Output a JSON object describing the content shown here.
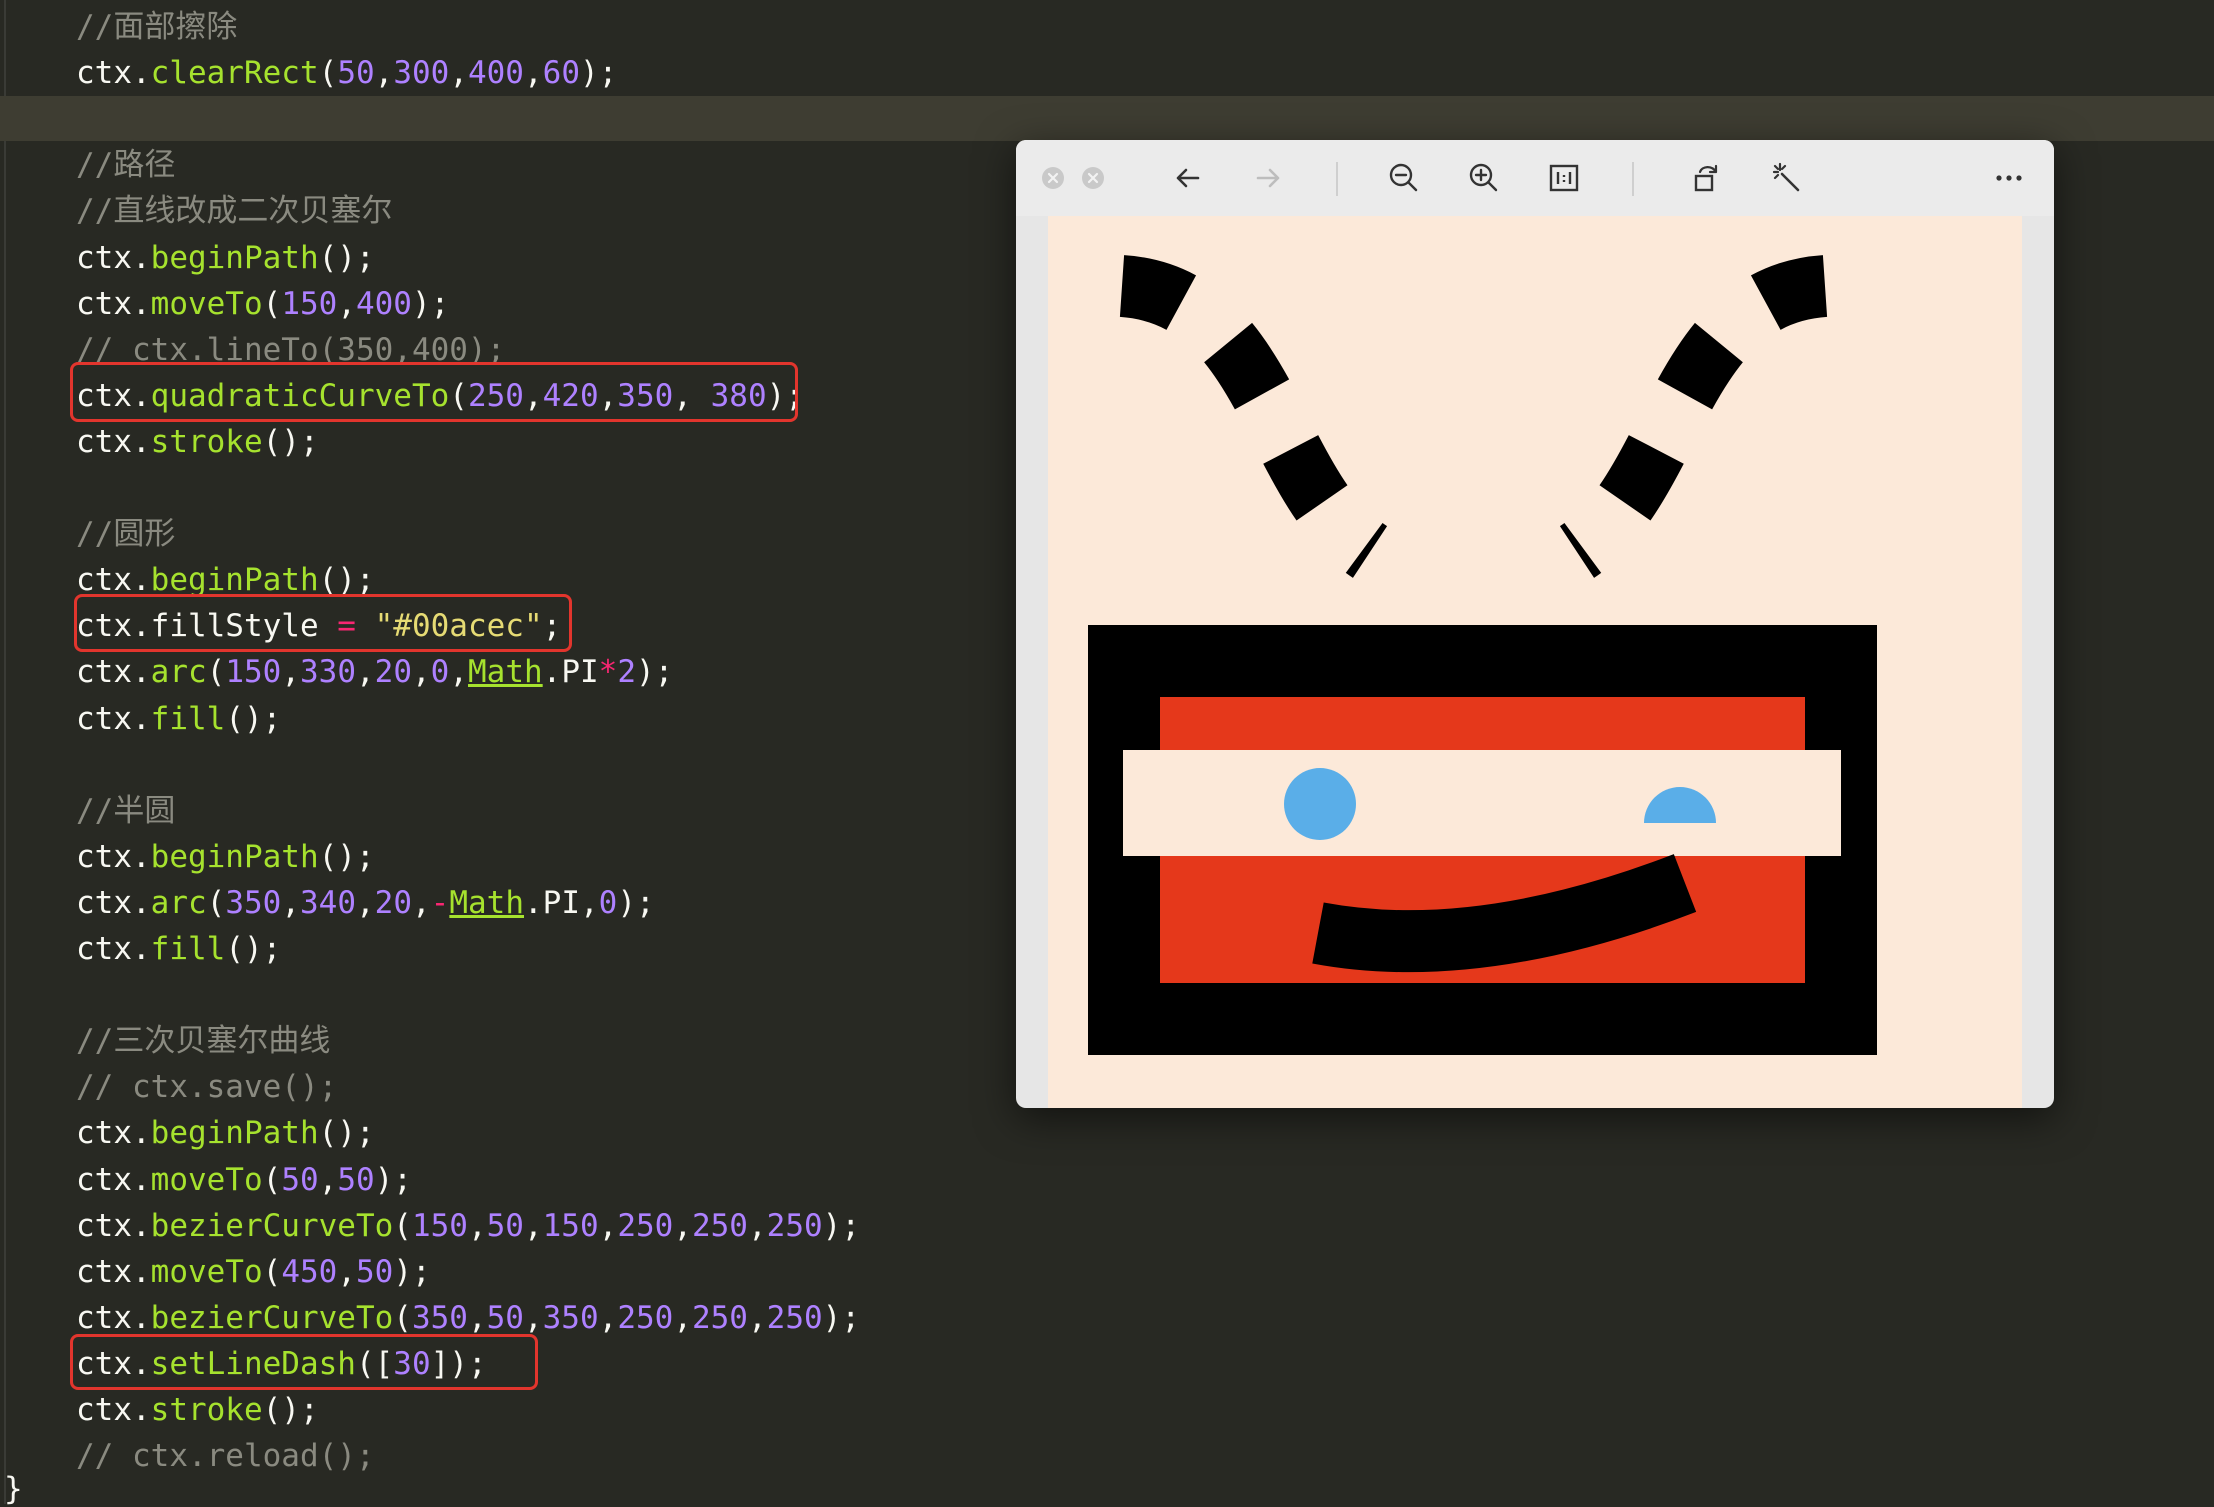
{
  "editor": {
    "lines": [
      [
        {
          "t": "//面部擦除",
          "c": "cm"
        }
      ],
      [
        {
          "t": "ctx.",
          "c": "punc"
        },
        {
          "t": "clearRect",
          "c": "fn"
        },
        {
          "t": "(",
          "c": "punc"
        },
        {
          "t": "50",
          "c": "num"
        },
        {
          "t": ",",
          "c": "punc"
        },
        {
          "t": "300",
          "c": "num"
        },
        {
          "t": ",",
          "c": "punc"
        },
        {
          "t": "400",
          "c": "num"
        },
        {
          "t": ",",
          "c": "punc"
        },
        {
          "t": "60",
          "c": "num"
        },
        {
          "t": ");",
          "c": "punc"
        }
      ],
      [],
      [
        {
          "t": "//路径",
          "c": "cm"
        }
      ],
      [
        {
          "t": "//直线改成二次贝塞尔",
          "c": "cm"
        }
      ],
      [
        {
          "t": "ctx.",
          "c": "punc"
        },
        {
          "t": "beginPath",
          "c": "fn"
        },
        {
          "t": "();",
          "c": "punc"
        }
      ],
      [
        {
          "t": "ctx.",
          "c": "punc"
        },
        {
          "t": "moveTo",
          "c": "fn"
        },
        {
          "t": "(",
          "c": "punc"
        },
        {
          "t": "150",
          "c": "num"
        },
        {
          "t": ",",
          "c": "punc"
        },
        {
          "t": "400",
          "c": "num"
        },
        {
          "t": ");",
          "c": "punc"
        }
      ],
      [
        {
          "t": "// ctx.lineTo(350,400);",
          "c": "cm"
        }
      ],
      [
        {
          "t": "ctx.",
          "c": "punc"
        },
        {
          "t": "quadraticCurveTo",
          "c": "fn"
        },
        {
          "t": "(",
          "c": "punc"
        },
        {
          "t": "250",
          "c": "num"
        },
        {
          "t": ",",
          "c": "punc"
        },
        {
          "t": "420",
          "c": "num"
        },
        {
          "t": ",",
          "c": "punc"
        },
        {
          "t": "350",
          "c": "num"
        },
        {
          "t": ", ",
          "c": "punc"
        },
        {
          "t": "380",
          "c": "num"
        },
        {
          "t": ");",
          "c": "punc"
        }
      ],
      [
        {
          "t": "ctx.",
          "c": "punc"
        },
        {
          "t": "stroke",
          "c": "fn"
        },
        {
          "t": "();",
          "c": "punc"
        }
      ],
      [],
      [
        {
          "t": "//圆形",
          "c": "cm"
        }
      ],
      [
        {
          "t": "ctx.",
          "c": "punc"
        },
        {
          "t": "beginPath",
          "c": "fn"
        },
        {
          "t": "();",
          "c": "punc"
        }
      ],
      [
        {
          "t": "ctx.fillStyle ",
          "c": "punc"
        },
        {
          "t": "=",
          "c": "op"
        },
        {
          "t": " ",
          "c": "punc"
        },
        {
          "t": "\"#00acec\"",
          "c": "str"
        },
        {
          "t": ";",
          "c": "punc"
        }
      ],
      [
        {
          "t": "ctx.",
          "c": "punc"
        },
        {
          "t": "arc",
          "c": "fn"
        },
        {
          "t": "(",
          "c": "punc"
        },
        {
          "t": "150",
          "c": "num"
        },
        {
          "t": ",",
          "c": "punc"
        },
        {
          "t": "330",
          "c": "num"
        },
        {
          "t": ",",
          "c": "punc"
        },
        {
          "t": "20",
          "c": "num"
        },
        {
          "t": ",",
          "c": "punc"
        },
        {
          "t": "0",
          "c": "num"
        },
        {
          "t": ",",
          "c": "punc"
        },
        {
          "t": "Math",
          "c": "kw"
        },
        {
          "t": ".PI",
          "c": "punc"
        },
        {
          "t": "*",
          "c": "op"
        },
        {
          "t": "2",
          "c": "num"
        },
        {
          "t": ");",
          "c": "punc"
        }
      ],
      [
        {
          "t": "ctx.",
          "c": "punc"
        },
        {
          "t": "fill",
          "c": "fn"
        },
        {
          "t": "();",
          "c": "punc"
        }
      ],
      [],
      [
        {
          "t": "//半圆",
          "c": "cm"
        }
      ],
      [
        {
          "t": "ctx.",
          "c": "punc"
        },
        {
          "t": "beginPath",
          "c": "fn"
        },
        {
          "t": "();",
          "c": "punc"
        }
      ],
      [
        {
          "t": "ctx.",
          "c": "punc"
        },
        {
          "t": "arc",
          "c": "fn"
        },
        {
          "t": "(",
          "c": "punc"
        },
        {
          "t": "350",
          "c": "num"
        },
        {
          "t": ",",
          "c": "punc"
        },
        {
          "t": "340",
          "c": "num"
        },
        {
          "t": ",",
          "c": "punc"
        },
        {
          "t": "20",
          "c": "num"
        },
        {
          "t": ",",
          "c": "punc"
        },
        {
          "t": "-",
          "c": "op"
        },
        {
          "t": "Math",
          "c": "kw"
        },
        {
          "t": ".PI,",
          "c": "punc"
        },
        {
          "t": "0",
          "c": "num"
        },
        {
          "t": ");",
          "c": "punc"
        }
      ],
      [
        {
          "t": "ctx.",
          "c": "punc"
        },
        {
          "t": "fill",
          "c": "fn"
        },
        {
          "t": "();",
          "c": "punc"
        }
      ],
      [],
      [
        {
          "t": "//三次贝塞尔曲线",
          "c": "cm"
        }
      ],
      [
        {
          "t": "// ctx.save();",
          "c": "cm"
        }
      ],
      [
        {
          "t": "ctx.",
          "c": "punc"
        },
        {
          "t": "beginPath",
          "c": "fn"
        },
        {
          "t": "();",
          "c": "punc"
        }
      ],
      [
        {
          "t": "ctx.",
          "c": "punc"
        },
        {
          "t": "moveTo",
          "c": "fn"
        },
        {
          "t": "(",
          "c": "punc"
        },
        {
          "t": "50",
          "c": "num"
        },
        {
          "t": ",",
          "c": "punc"
        },
        {
          "t": "50",
          "c": "num"
        },
        {
          "t": ");",
          "c": "punc"
        }
      ],
      [
        {
          "t": "ctx.",
          "c": "punc"
        },
        {
          "t": "bezierCurveTo",
          "c": "fn"
        },
        {
          "t": "(",
          "c": "punc"
        },
        {
          "t": "150",
          "c": "num"
        },
        {
          "t": ",",
          "c": "punc"
        },
        {
          "t": "50",
          "c": "num"
        },
        {
          "t": ",",
          "c": "punc"
        },
        {
          "t": "150",
          "c": "num"
        },
        {
          "t": ",",
          "c": "punc"
        },
        {
          "t": "250",
          "c": "num"
        },
        {
          "t": ",",
          "c": "punc"
        },
        {
          "t": "250",
          "c": "num"
        },
        {
          "t": ",",
          "c": "punc"
        },
        {
          "t": "250",
          "c": "num"
        },
        {
          "t": ");",
          "c": "punc"
        }
      ],
      [
        {
          "t": "ctx.",
          "c": "punc"
        },
        {
          "t": "moveTo",
          "c": "fn"
        },
        {
          "t": "(",
          "c": "punc"
        },
        {
          "t": "450",
          "c": "num"
        },
        {
          "t": ",",
          "c": "punc"
        },
        {
          "t": "50",
          "c": "num"
        },
        {
          "t": ");",
          "c": "punc"
        }
      ],
      [
        {
          "t": "ctx.",
          "c": "punc"
        },
        {
          "t": "bezierCurveTo",
          "c": "fn"
        },
        {
          "t": "(",
          "c": "punc"
        },
        {
          "t": "350",
          "c": "num"
        },
        {
          "t": ",",
          "c": "punc"
        },
        {
          "t": "50",
          "c": "num"
        },
        {
          "t": ",",
          "c": "punc"
        },
        {
          "t": "350",
          "c": "num"
        },
        {
          "t": ",",
          "c": "punc"
        },
        {
          "t": "250",
          "c": "num"
        },
        {
          "t": ",",
          "c": "punc"
        },
        {
          "t": "250",
          "c": "num"
        },
        {
          "t": ",",
          "c": "punc"
        },
        {
          "t": "250",
          "c": "num"
        },
        {
          "t": ");",
          "c": "punc"
        }
      ],
      [
        {
          "t": "ctx.",
          "c": "punc"
        },
        {
          "t": "setLineDash",
          "c": "fn"
        },
        {
          "t": "([",
          "c": "punc"
        },
        {
          "t": "30",
          "c": "num"
        },
        {
          "t": "]);",
          "c": "punc"
        }
      ],
      [
        {
          "t": "ctx.",
          "c": "punc"
        },
        {
          "t": "stroke",
          "c": "fn"
        },
        {
          "t": "();",
          "c": "punc"
        }
      ],
      [
        {
          "t": "// ctx.reload();",
          "c": "cm"
        }
      ]
    ],
    "closing_brace": "}",
    "highlighted_lines": [
      8,
      13,
      29
    ],
    "current_line": 2,
    "colors": {
      "bg": "#282923",
      "comment": "#8a8a80",
      "function": "#a6e22e",
      "number": "#ae81ff",
      "string": "#e6db74",
      "operator": "#f92672",
      "text": "#f8f8f2",
      "highlight_box": "#e2352d"
    }
  },
  "viewer": {
    "toolbar": {
      "close": "close-icon",
      "minimize": "minimize-icon",
      "back": "arrow-left-icon",
      "forward": "arrow-right-icon",
      "zoom_out": "zoom-out-icon",
      "zoom_in": "zoom-in-icon",
      "actual_size": "actual-size-icon",
      "rotate": "rotate-icon",
      "enhance": "magic-wand-icon",
      "more": "more-icon"
    },
    "canvas": {
      "background": "#fce9d9",
      "frame_color": "#000000",
      "face_color": "#e5381b",
      "eye_color": "#5aaee8",
      "band_color": "#fce9d9"
    }
  }
}
